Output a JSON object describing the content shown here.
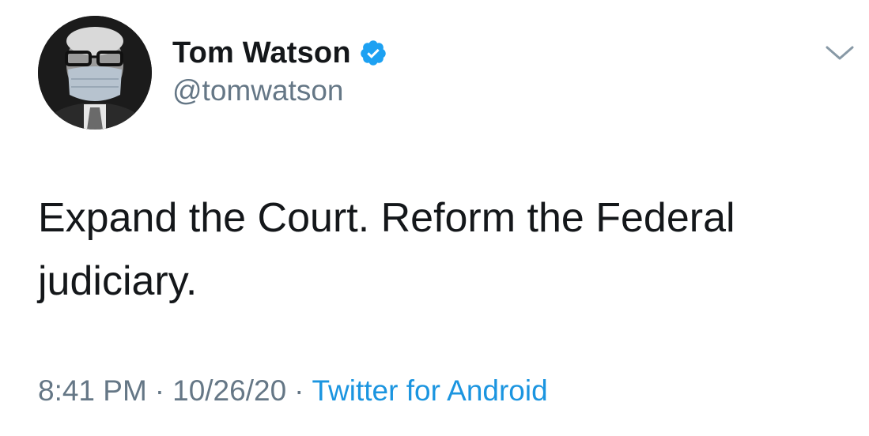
{
  "author": {
    "display_name": "Tom Watson",
    "handle": "@tomwatson",
    "verified": true
  },
  "tweet": {
    "text": "Expand the Court. Reform the Federal judiciary.",
    "time": "8:41 PM",
    "separator": "·",
    "date": "10/26/20",
    "source": "Twitter for Android"
  },
  "icons": {
    "verified": "verified-badge-icon",
    "menu": "chevron-down-icon"
  },
  "colors": {
    "text": "#14171a",
    "secondary": "#657786",
    "link": "#1b95e0",
    "verified": "#1da1f2"
  }
}
